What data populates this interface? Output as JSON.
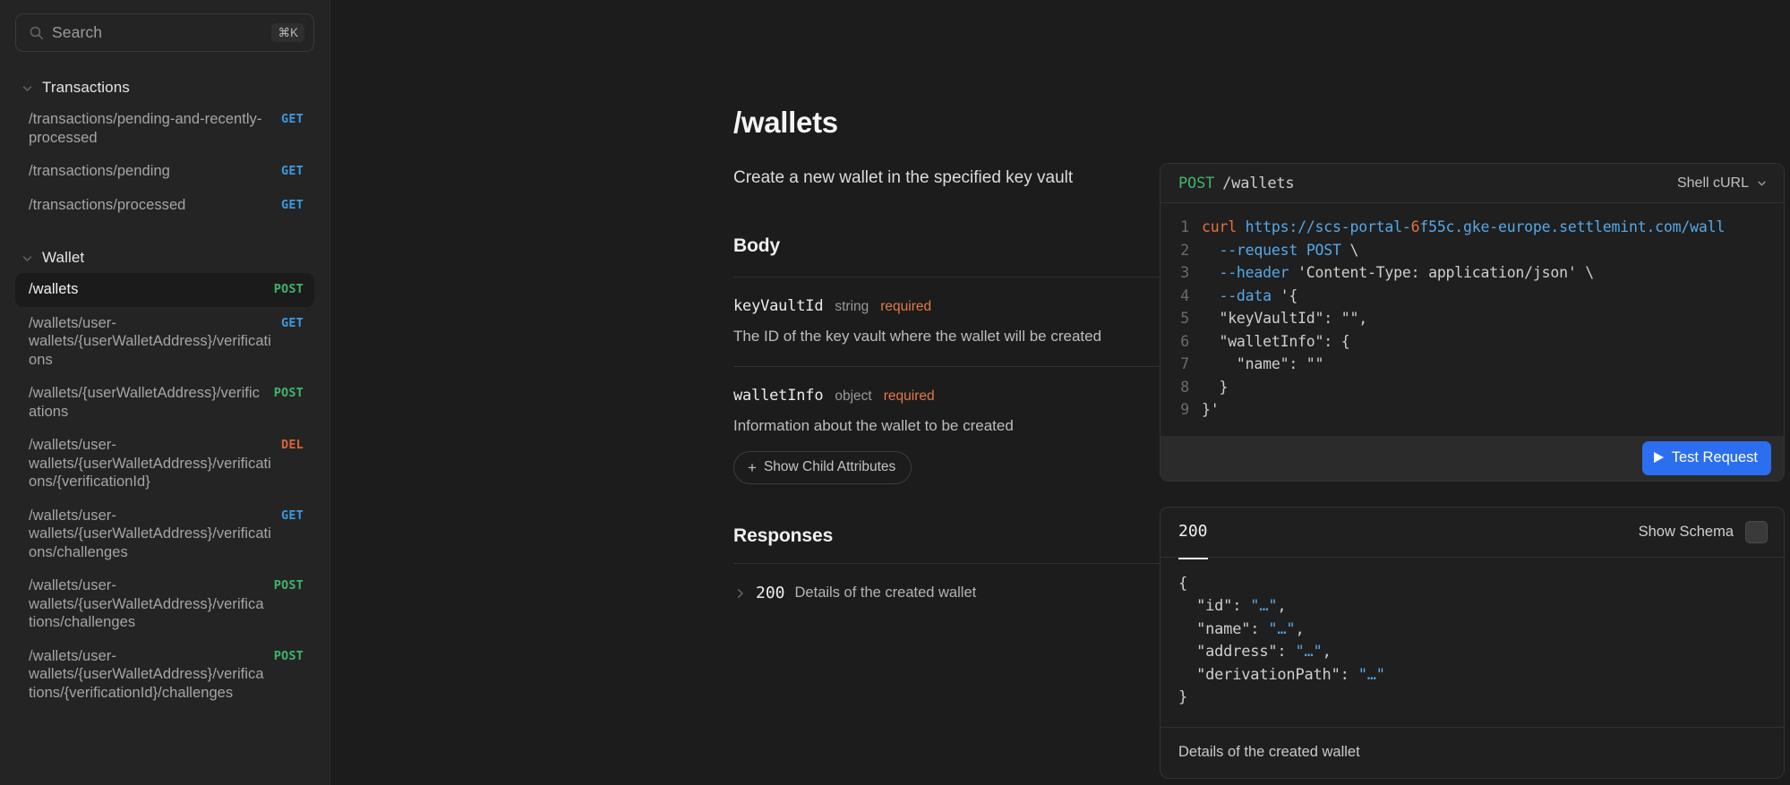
{
  "sidebar": {
    "search": {
      "placeholder": "Search",
      "shortcut": "⌘K",
      "icon": "search-icon"
    },
    "groups": [
      {
        "title": "Transactions",
        "items": [
          {
            "label": "/transactions/pending-and-recently-processed",
            "verb": "GET",
            "active": false
          },
          {
            "label": "/transactions/pending",
            "verb": "GET",
            "active": false
          },
          {
            "label": "/transactions/processed",
            "verb": "GET",
            "active": false
          }
        ]
      },
      {
        "title": "Wallet",
        "items": [
          {
            "label": "/wallets",
            "verb": "POST",
            "active": true
          },
          {
            "label": "/wallets/user-wallets/{userWalletAddress}/verifications",
            "verb": "GET",
            "active": false
          },
          {
            "label": "/wallets/{userWalletAddress}/verifications",
            "verb": "POST",
            "active": false
          },
          {
            "label": "/wallets/user-wallets/{userWalletAddress}/verifications/{verificationId}",
            "verb": "DEL",
            "active": false
          },
          {
            "label": "/wallets/user-wallets/{userWalletAddress}/verifications/challenges",
            "verb": "GET",
            "active": false
          },
          {
            "label": "/wallets/user-wallets/{userWalletAddress}/verifications/challenges",
            "verb": "POST",
            "active": false
          },
          {
            "label": "/wallets/user-wallets/{userWalletAddress}/verifications/{verificationId}/challenges",
            "verb": "POST",
            "active": false
          }
        ]
      }
    ]
  },
  "doc": {
    "title": "/wallets",
    "description": "Create a new wallet in the specified key vault",
    "body_section_title": "Body",
    "mime": "application/json",
    "attributes": [
      {
        "name": "keyVaultId",
        "type": "string",
        "required_label": "required",
        "description": "The ID of the key vault where the wallet will be created",
        "child_button": null
      },
      {
        "name": "walletInfo",
        "type": "object",
        "required_label": "required",
        "description": "Information about the wallet to be created",
        "child_button": "Show Child Attributes"
      }
    ],
    "responses_title": "Responses",
    "responses": [
      {
        "code": "200",
        "text": "Details of the created wallet"
      }
    ]
  },
  "request_panel": {
    "method": "POST",
    "path": "/wallets",
    "language": "Shell cURL",
    "test_button": "Test Request",
    "code_lines": [
      {
        "n": "1",
        "segments": [
          {
            "t": "curl ",
            "c": "cmd"
          },
          {
            "t": "https://scs-portal-",
            "c": "url"
          },
          {
            "t": "6",
            "c": "num"
          },
          {
            "t": "f55c.gke-",
            "c": "url"
          },
          {
            "t": "europe.settlemint.com/wall",
            "c": "url"
          }
        ]
      },
      {
        "n": "2",
        "segments": [
          {
            "t": "  ",
            "c": "plain"
          },
          {
            "t": "--request ",
            "c": "flag"
          },
          {
            "t": "POST ",
            "c": "flag"
          },
          {
            "t": "\\",
            "c": "plain"
          }
        ]
      },
      {
        "n": "3",
        "segments": [
          {
            "t": "  ",
            "c": "plain"
          },
          {
            "t": "--header ",
            "c": "flag"
          },
          {
            "t": "'Content-Type: application/json' \\",
            "c": "plain"
          }
        ]
      },
      {
        "n": "4",
        "segments": [
          {
            "t": "  ",
            "c": "plain"
          },
          {
            "t": "--data ",
            "c": "flag"
          },
          {
            "t": "'{",
            "c": "plain"
          }
        ]
      },
      {
        "n": "5",
        "segments": [
          {
            "t": "  \"keyVaultId\": \"\",",
            "c": "plain"
          }
        ]
      },
      {
        "n": "6",
        "segments": [
          {
            "t": "  \"walletInfo\": {",
            "c": "plain"
          }
        ]
      },
      {
        "n": "7",
        "segments": [
          {
            "t": "    \"name\": \"\"",
            "c": "plain"
          }
        ]
      },
      {
        "n": "8",
        "segments": [
          {
            "t": "  }",
            "c": "plain"
          }
        ]
      },
      {
        "n": "9",
        "segments": [
          {
            "t": "}'",
            "c": "plain"
          }
        ]
      }
    ]
  },
  "response_panel": {
    "status": "200",
    "schema_label": "Show Schema",
    "schema_enabled": false,
    "footer": "Details of the created wallet",
    "json_lines": [
      {
        "segments": [
          {
            "t": "{",
            "c": "k"
          }
        ]
      },
      {
        "segments": [
          {
            "t": "  \"id\": ",
            "c": "k"
          },
          {
            "t": "\"…\"",
            "c": "s"
          },
          {
            "t": ",",
            "c": "k"
          }
        ]
      },
      {
        "segments": [
          {
            "t": "  \"name\": ",
            "c": "k"
          },
          {
            "t": "\"…\"",
            "c": "s"
          },
          {
            "t": ",",
            "c": "k"
          }
        ]
      },
      {
        "segments": [
          {
            "t": "  \"address\": ",
            "c": "k"
          },
          {
            "t": "\"…\"",
            "c": "s"
          },
          {
            "t": ",",
            "c": "k"
          }
        ]
      },
      {
        "segments": [
          {
            "t": "  \"derivationPath\": ",
            "c": "k"
          },
          {
            "t": "\"…\"",
            "c": "s"
          }
        ]
      },
      {
        "segments": [
          {
            "t": "}",
            "c": "k"
          }
        ]
      }
    ]
  },
  "colors": {
    "accent_blue": "#2b6ff0",
    "verb_get": "#3d9ae0",
    "verb_post": "#3fb56d",
    "verb_delete": "#d8613c",
    "required_orange": "#e07a4a",
    "background": "#1c1c1c",
    "sidebar_background": "#242424"
  }
}
